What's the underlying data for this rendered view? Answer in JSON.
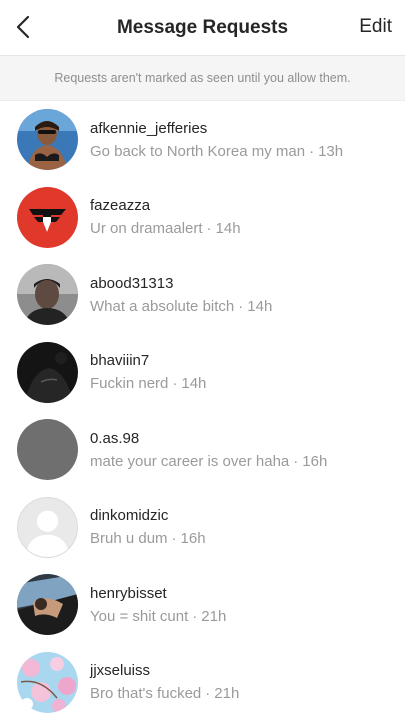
{
  "header": {
    "title": "Message Requests",
    "edit_label": "Edit",
    "back_icon": "chevron-left-icon"
  },
  "notice": "Requests aren't marked as seen until you allow them.",
  "requests": [
    {
      "username": "afkennie_jefferies",
      "message": "Go back to North Korea my man",
      "time": "13h",
      "avatar": "photo-person"
    },
    {
      "username": "fazeazza",
      "message": "Ur on dramaalert",
      "time": "14h",
      "avatar": "faze-logo"
    },
    {
      "username": "abood31313",
      "message": "What a absolute bitch",
      "time": "14h",
      "avatar": "photo-person"
    },
    {
      "username": "bhaviiin7",
      "message": "Fuckin nerd",
      "time": "14h",
      "avatar": "photo-dark"
    },
    {
      "username": "0.as.98",
      "message": "mate your career is over haha",
      "time": "16h",
      "avatar": "photo-grey"
    },
    {
      "username": "dinkomidzic",
      "message": "Bruh u dum",
      "time": "16h",
      "avatar": "default-avatar"
    },
    {
      "username": "henrybisset",
      "message": "You = shit cunt",
      "time": "21h",
      "avatar": "photo-car"
    },
    {
      "username": "jjxseluiss",
      "message": "Bro that's fucked",
      "time": "21h",
      "avatar": "photo-blossom"
    }
  ],
  "colors": {
    "faze_red": "#e0392b",
    "muted_text": "#9a9a9a"
  }
}
